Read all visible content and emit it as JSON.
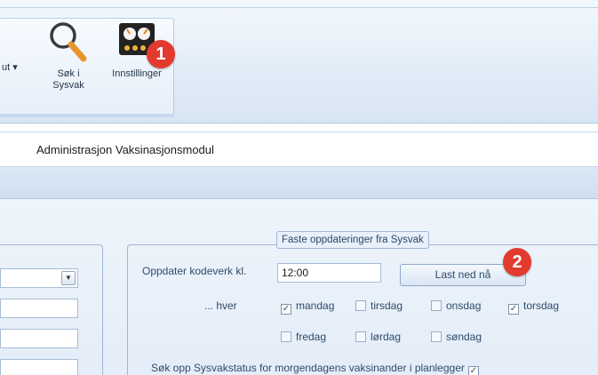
{
  "ribbon": {
    "out_label": "ut",
    "out_arrow": "▾",
    "search_button": {
      "line1": "Søk i",
      "line2": "Sysvak",
      "icon": "magnifier-icon"
    },
    "settings_button": {
      "label": "Innstillinger",
      "icon": "settings-panel-icon"
    }
  },
  "annotations": {
    "badge1": "1",
    "badge2": "2",
    "badge_color": "#e23a2e"
  },
  "page": {
    "title": "Administrasjon Vaksinasjonsmodul"
  },
  "schedule": {
    "legend": "Faste oppdateringer fra Sysvak",
    "update_label": "Oppdater kodeverk kl.",
    "time_value": "12:00",
    "download_button": "Last ned nå",
    "every_label": "... hver",
    "days": [
      {
        "label": "mandag",
        "checked": true
      },
      {
        "label": "tirsdag",
        "checked": false
      },
      {
        "label": "onsdag",
        "checked": false
      },
      {
        "label": "torsdag",
        "checked": true
      },
      {
        "label": "fredag",
        "checked": false
      },
      {
        "label": "lørdag",
        "checked": false
      },
      {
        "label": "søndag",
        "checked": false
      }
    ],
    "status_label": "Søk opp Sysvakstatus for morgendagens vaksinander i planlegger",
    "status_checked": true
  },
  "colors": {
    "ribbon_bg": "#e3edf8",
    "panel_border": "#9fb7d4",
    "label_text": "#2f4b6b"
  }
}
